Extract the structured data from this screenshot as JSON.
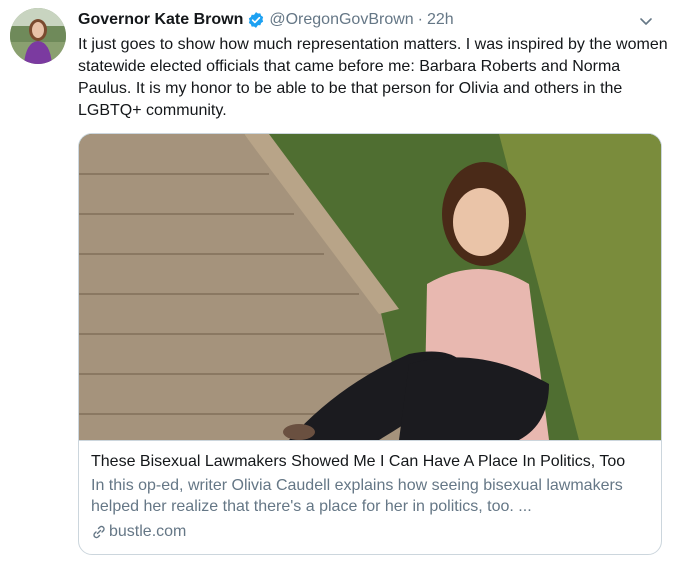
{
  "tweet": {
    "author_name": "Governor Kate Brown",
    "handle": "@OregonGovBrown",
    "separator": "·",
    "time": "22h",
    "text": "It just goes to show how much representation matters. I was inspired by the women statewide elected officials that came before me: Barbara Roberts and Norma Paulus. It is my honor to be able to be that person for Olivia and others in the LGBTQ+ community."
  },
  "card": {
    "title": "These Bisexual Lawmakers Showed Me I Can Have A Place In Politics, Too",
    "description": "In this op-ed, writer Olivia Caudell explains how seeing bisexual lawmakers helped her realize that there's a place for her in politics, too. ...",
    "domain": "bustle.com"
  },
  "icons": {
    "verified": "verified-badge-icon",
    "menu": "chevron-down-icon",
    "link": "link-icon"
  },
  "colors": {
    "verified": "#1da1f2",
    "secondary_text": "#657786",
    "border": "#ccd6dd"
  }
}
